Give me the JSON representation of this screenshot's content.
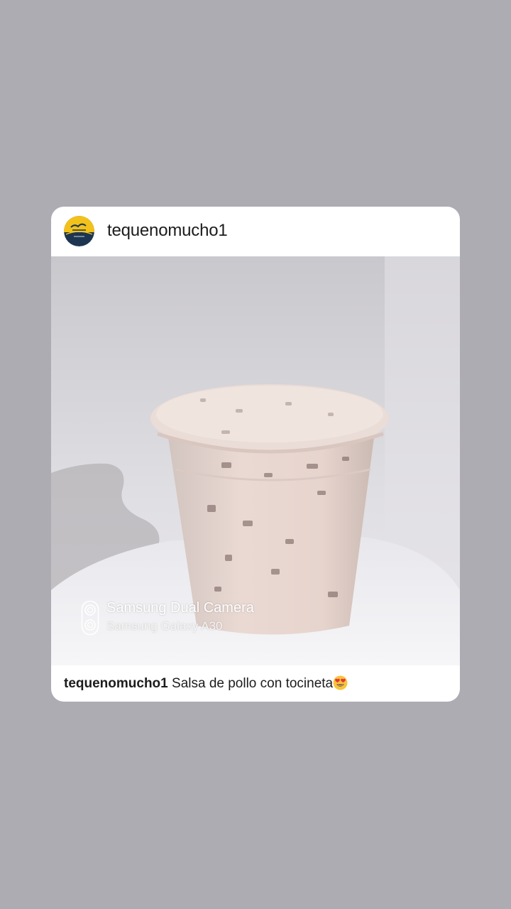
{
  "post": {
    "username": "tequenomucho1",
    "photo": {
      "description_icon": "cup-of-sauce-photo",
      "watermark": {
        "icon": "dual-camera-icon",
        "line1": "Samsung Dual Camera",
        "line2": "Samsung Galaxy A30"
      }
    },
    "caption": {
      "username": "tequenomucho1",
      "text": "Salsa de pollo con tocineta",
      "emoji": "heart-eyes-emoji"
    }
  },
  "colors": {
    "background": "#adacb3",
    "card": "#ffffff",
    "text": "#1c1c1e"
  }
}
